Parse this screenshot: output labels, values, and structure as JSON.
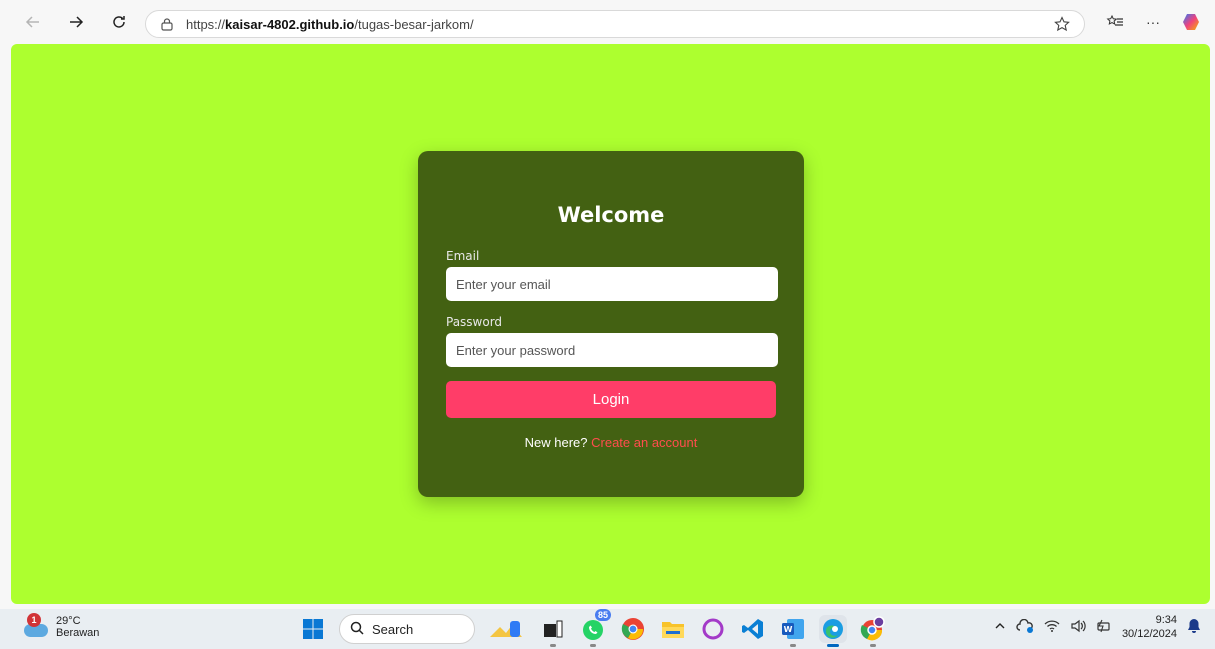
{
  "browser": {
    "url_prefix": "https://",
    "url_host": "kaisar-4802.github.io",
    "url_path": "/tugas-besar-jarkom/",
    "more_label": "···"
  },
  "login": {
    "title": "Welcome",
    "email_label": "Email",
    "email_placeholder": "Enter your email",
    "password_label": "Password",
    "password_placeholder": "Enter your password",
    "login_button": "Login",
    "signup_prompt": "New here?",
    "signup_link": "Create an account"
  },
  "colors": {
    "page_bg": "#adff2f",
    "card_bg": "#436112",
    "button_bg": "#ff3d68",
    "link": "#ff4d4d"
  },
  "taskbar": {
    "weather_badge": "1",
    "temperature": "29°C",
    "weather_desc": "Berawan",
    "search_label": "Search",
    "whatsapp_badge": "85",
    "time": "9:34",
    "date": "30/12/2024"
  }
}
